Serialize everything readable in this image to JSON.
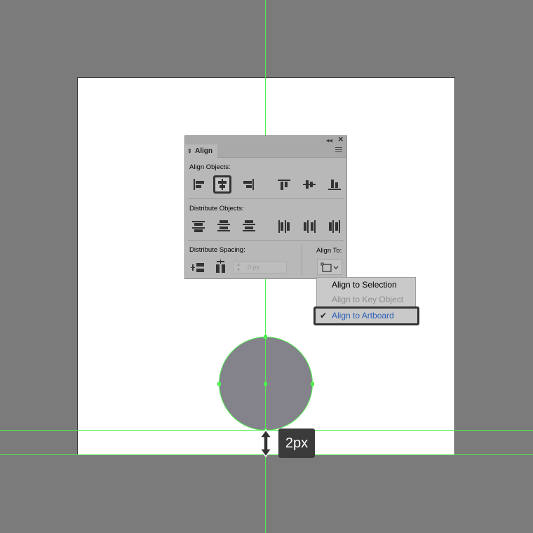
{
  "canvas": {
    "background_color": "#7b7b7b",
    "artboard_color": "#ffffff",
    "guide_color": "#4ff04f",
    "circle_fill": "#84828b"
  },
  "measurement": {
    "label": "2px"
  },
  "align_panel": {
    "tab_label": "Align",
    "align_objects_label": "Align Objects:",
    "distribute_objects_label": "Distribute Objects:",
    "distribute_spacing_label": "Distribute Spacing:",
    "align_to_label": "Align To:",
    "spacing_value_placeholder": "0 px",
    "align_objects_buttons": [
      "horizontal-align-left-icon",
      "horizontal-align-center-icon",
      "horizontal-align-right-icon",
      "vertical-align-top-icon",
      "vertical-align-center-icon",
      "vertical-align-bottom-icon"
    ],
    "selected_align_button": "horizontal-align-center-icon"
  },
  "align_to_menu": {
    "items": [
      {
        "label": "Align to Selection",
        "enabled": true
      },
      {
        "label": "Align to Key Object",
        "enabled": false
      },
      {
        "label": "Align to Artboard",
        "enabled": true,
        "checked": true
      }
    ],
    "selected_color": "#2b5fb8"
  }
}
